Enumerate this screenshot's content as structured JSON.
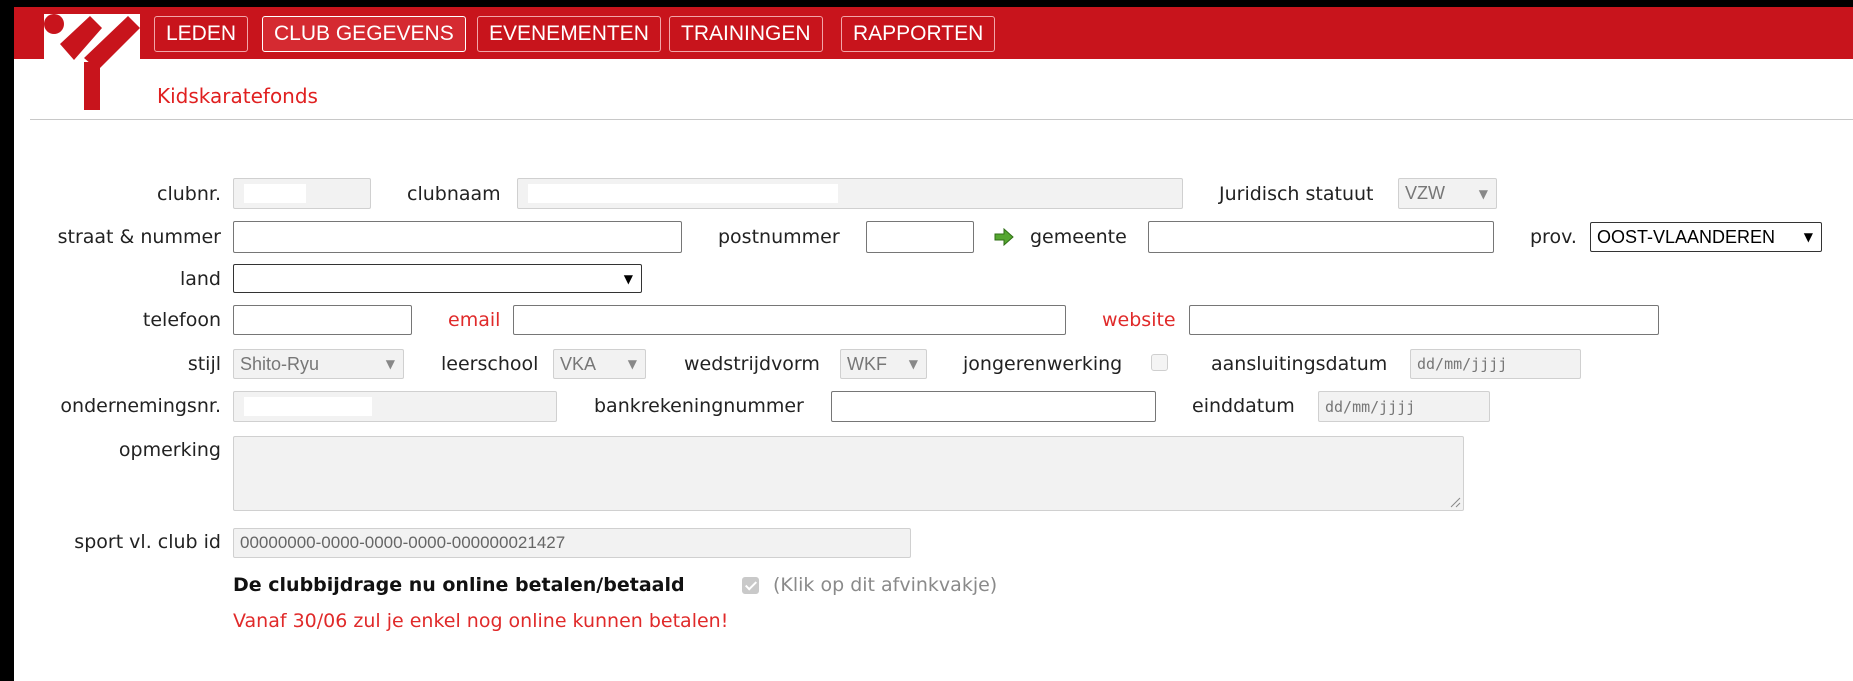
{
  "nav": [
    "LEDEN",
    "CLUB GEGEVENS",
    "EVENEMENTEN",
    "TRAININGEN",
    "RAPPORTEN"
  ],
  "subtitle": "Kidskaratefonds",
  "form": {
    "clubnr_label": "clubnr.",
    "clubnaam_label": "clubnaam",
    "juridisch_label": "Juridisch statuut",
    "juridisch_value": "VZW",
    "straat_label": "straat & nummer",
    "postnummer_label": "postnummer",
    "gemeente_label": "gemeente",
    "prov_label": "prov.",
    "prov_value": "OOST-VLAANDEREN",
    "land_label": "land",
    "land_value": "",
    "telefoon_label": "telefoon",
    "email_label": "email",
    "website_label": "website",
    "stijl_label": "stijl",
    "stijl_value": "Shito-Ryu",
    "leerschool_label": "leerschool",
    "leerschool_value": "VKA",
    "wedstrijdvorm_label": "wedstrijdvorm",
    "wedstrijdvorm_value": "WKF",
    "jongerenwerking_label": "jongerenwerking",
    "aansluitingsdatum_label": "aansluitingsdatum",
    "aansluitingsdatum_placeholder": "dd/mm/jjjj",
    "ondernemingsnr_label": "ondernemingsnr.",
    "bankrekening_label": "bankrekeningnummer",
    "einddatum_label": "einddatum",
    "einddatum_placeholder": "dd/mm/jjjj",
    "opmerking_label": "opmerking",
    "sportvl_label": "sport vl. club id",
    "sportvl_value": "00000000-0000-0000-0000-000000021427"
  },
  "payment": {
    "bold": "De clubbijdrage nu online betalen/betaald",
    "note": "(Klik op dit afvinkvakje)",
    "warning": "Vanaf 30/06 zul je enkel nog online kunnen betalen!"
  },
  "colors": {
    "brand_red": "#c8141c",
    "label_red": "#e02a2a"
  },
  "icons": {
    "gemeente_lookup": "arrow-right-icon",
    "logo": "club-logo"
  }
}
